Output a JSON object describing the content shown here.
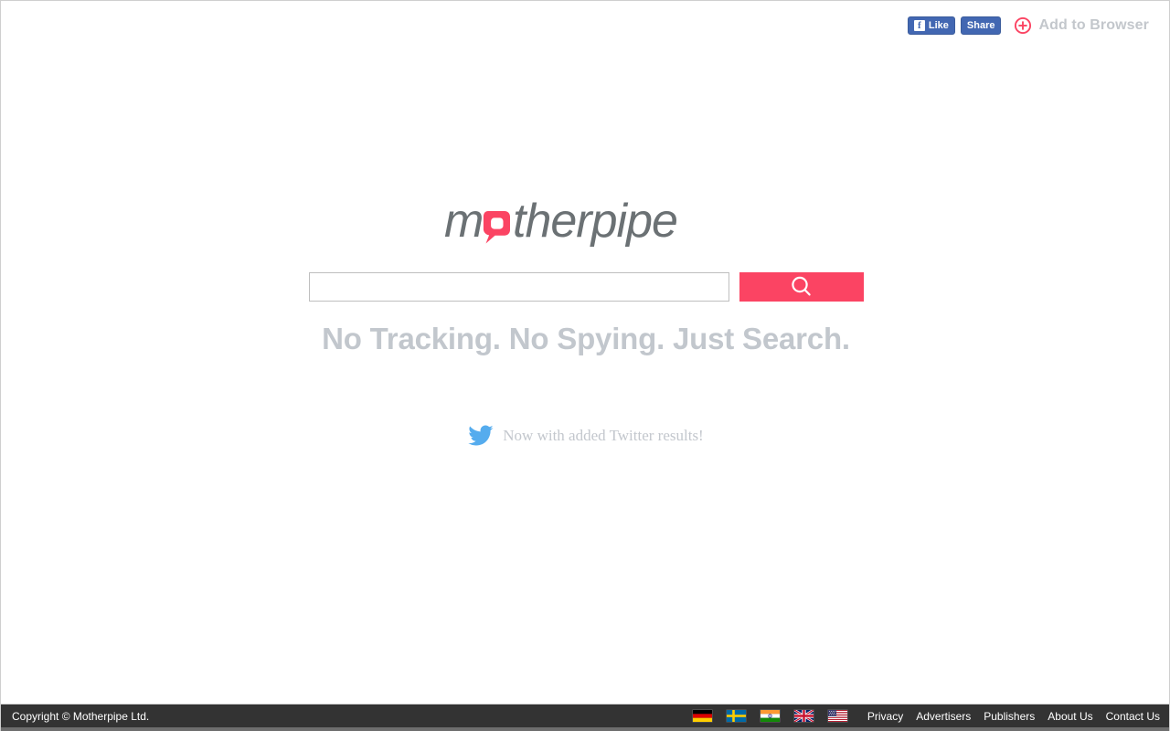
{
  "social": {
    "facebook_like_label": "Like",
    "facebook_share_label": "Share",
    "add_to_browser_label": "Add to Browser",
    "facebook_blue": "#4267b2",
    "accent_pink": "#fb4463"
  },
  "logo": {
    "text": "motherpipe",
    "gray": "#6b7174",
    "pink": "#fb4463"
  },
  "search": {
    "value": "",
    "placeholder": "",
    "button_icon": "search-icon",
    "button_color": "#fb4463"
  },
  "tagline": "No Tracking. No Spying. Just Search.",
  "twitter_note": {
    "icon": "twitter-bird-icon",
    "text": "Now with added Twitter results!",
    "icon_color": "#55acee"
  },
  "footer": {
    "copyright": "Copyright © Motherpipe Ltd.",
    "background": "#333333",
    "flags": [
      {
        "name": "flag-germany",
        "label": "Germany"
      },
      {
        "name": "flag-sweden",
        "label": "Sweden"
      },
      {
        "name": "flag-india",
        "label": "India"
      },
      {
        "name": "flag-uk",
        "label": "United Kingdom"
      },
      {
        "name": "flag-usa",
        "label": "United States"
      }
    ],
    "links": [
      {
        "label": "Privacy"
      },
      {
        "label": "Advertisers"
      },
      {
        "label": "Publishers"
      },
      {
        "label": "About Us"
      },
      {
        "label": "Contact Us"
      }
    ]
  }
}
